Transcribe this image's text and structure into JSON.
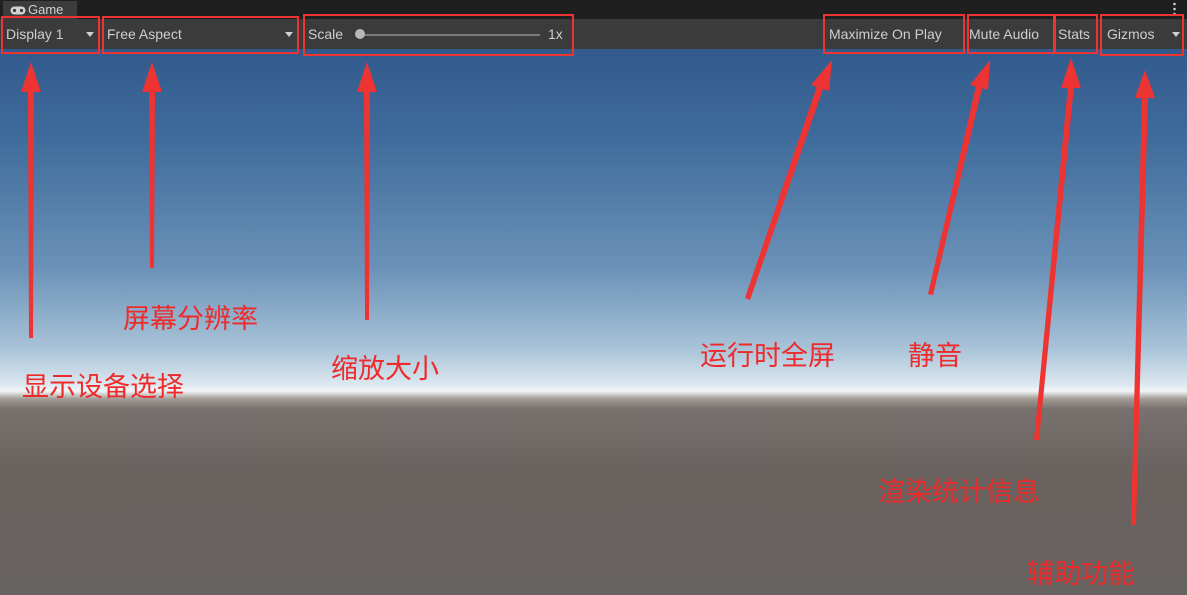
{
  "tab": {
    "title": "Game"
  },
  "toolbar": {
    "display": "Display 1",
    "aspect": "Free Aspect",
    "scale_label": "Scale",
    "scale_value": "1x",
    "maximize": "Maximize On Play",
    "mute": "Mute Audio",
    "stats": "Stats",
    "gizmos": "Gizmos"
  },
  "annotations": {
    "display": "显示设备选择",
    "aspect": "屏幕分辨率",
    "scale": "缩放大小",
    "maximize": "运行时全屏",
    "mute": "静音",
    "stats": "渲染统计信息",
    "gizmos": "辅助功能"
  },
  "colors": {
    "annotation": "#ee3333",
    "toolbar_bg": "#3b3b3b",
    "tabbar_bg": "#1f1f1f",
    "tab_bg": "#3c3c3c"
  },
  "icons": {
    "tab": "gamepad-icon",
    "menu": "kebab-menu-icon",
    "dropdown": "caret-down-icon"
  }
}
